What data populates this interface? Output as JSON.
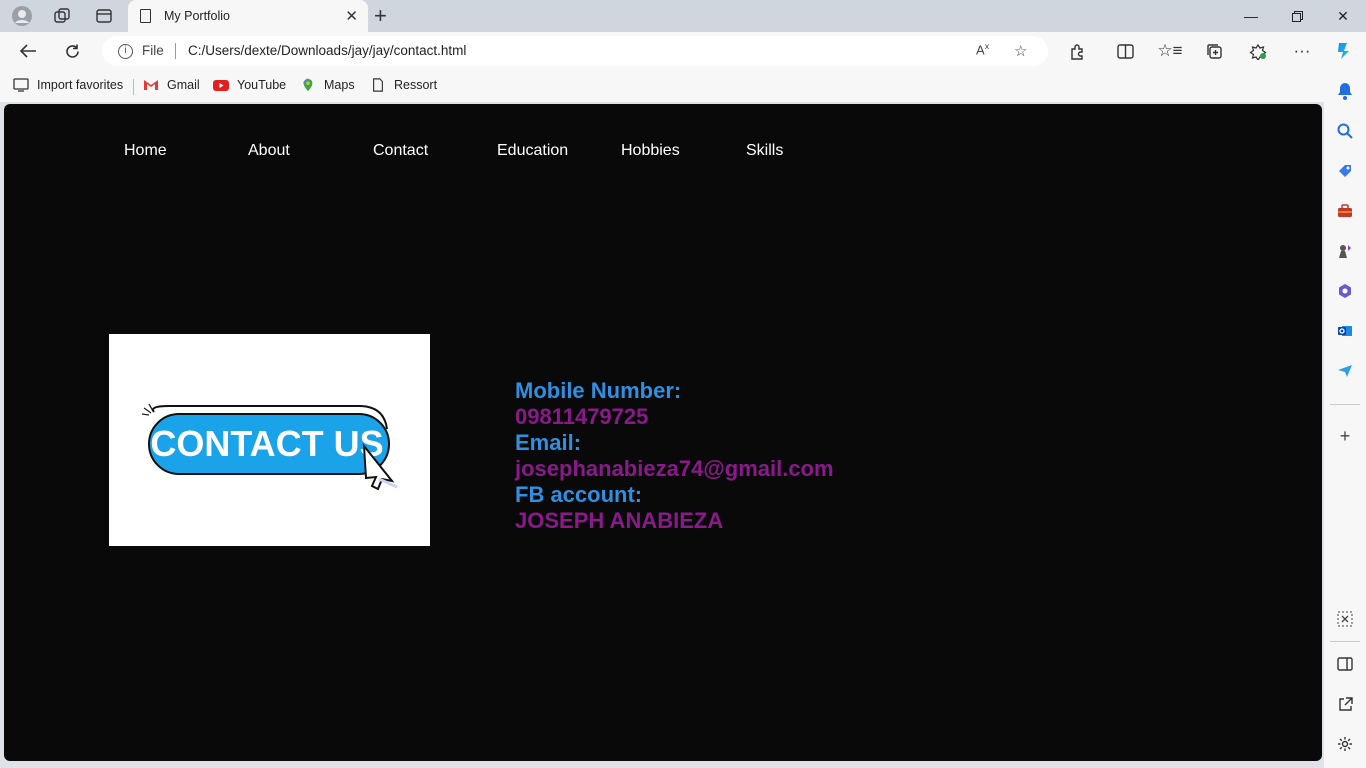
{
  "browser": {
    "tab_title": "My Portfolio",
    "address": {
      "scheme_label": "File",
      "url": "C:/Users/dexte/Downloads/jay/jay/contact.html"
    },
    "favorites": [
      {
        "label": "Import favorites",
        "icon": "import-icon"
      },
      {
        "label": "Gmail",
        "icon": "gmail-icon"
      },
      {
        "label": "YouTube",
        "icon": "youtube-icon"
      },
      {
        "label": "Maps",
        "icon": "maps-icon"
      },
      {
        "label": "Ressort",
        "icon": "page-icon"
      }
    ]
  },
  "page": {
    "nav": [
      "Home",
      "About",
      "Contact",
      "Education",
      "Hobbies",
      "Skills"
    ],
    "image_text": "CONTACT US",
    "contact": {
      "mobile_label": "Mobile Number:",
      "mobile_value": "09811479725",
      "email_label": "Email:",
      "email_value": "josephanabieza74@gmail.com",
      "fb_label": "FB account:",
      "fb_value": "JOSEPH ANABIEZA"
    }
  },
  "colors": {
    "page_bg": "#09090a",
    "label_blue": "#2f8fe0",
    "value_purple": "#8a1a8a",
    "button_blue": "#1aa3e8"
  }
}
